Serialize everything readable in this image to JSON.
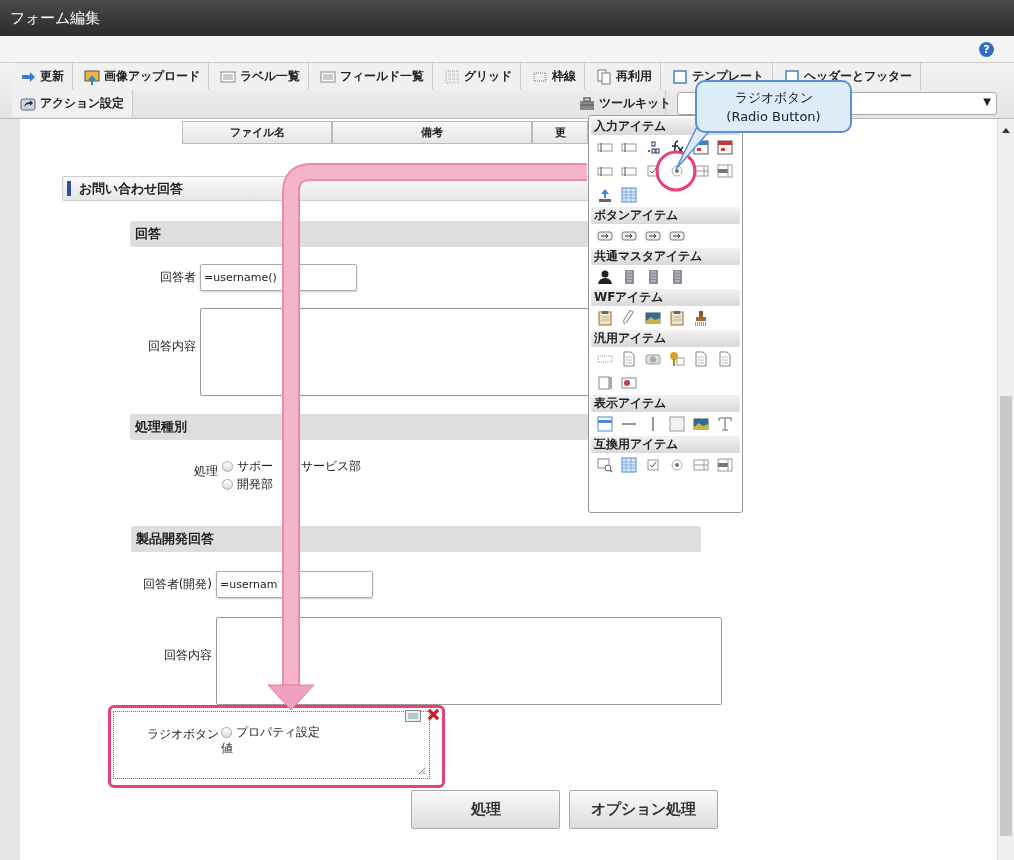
{
  "window": {
    "title": "フォーム編集",
    "help": "?"
  },
  "toolbar": {
    "tabs": [
      {
        "label": "更新"
      },
      {
        "label": "画像アップロード"
      },
      {
        "label": "ラベル一覧"
      },
      {
        "label": "フィールド一覧"
      },
      {
        "label": "グリッド"
      },
      {
        "label": "枠線"
      },
      {
        "label": "再利用"
      },
      {
        "label": "テンプレート"
      },
      {
        "label": "ヘッダーとフッター"
      }
    ],
    "row2": {
      "action": "アクション設定",
      "toolkit": "ツールキット",
      "dropdown_arrow": "▼"
    }
  },
  "table_header": {
    "columns": [
      "ファイル名",
      "備考",
      "更"
    ]
  },
  "form": {
    "section_title": "お問い合わせ回答",
    "groups": [
      {
        "title": "回答",
        "fields": [
          {
            "kind": "text",
            "label": "回答者",
            "value": "=username()"
          },
          {
            "kind": "textarea",
            "label": "回答内容"
          }
        ]
      },
      {
        "title": "処理種別",
        "fields": [
          {
            "kind": "radio",
            "label": "処理",
            "options": [
              {
                "label_parts": [
                  "サポー",
                  "サービス部"
                ],
                "selected": false
              },
              {
                "label": "開発部",
                "selected": false
              }
            ]
          }
        ]
      },
      {
        "title": "製品開発回答",
        "fields": [
          {
            "kind": "text",
            "label": "回答者(開発)",
            "value": "=usernam"
          },
          {
            "kind": "textarea",
            "label": "回答内容"
          }
        ]
      }
    ]
  },
  "selected_component": {
    "label": "ラジオボタン",
    "option": {
      "label": "プロパティ設定",
      "selected": false
    },
    "note": "値"
  },
  "buttons": [
    "処理",
    "オプション処理"
  ],
  "toolkit_panel": {
    "sections": [
      {
        "title": "入力アイテム"
      },
      {
        "title": "ボタンアイテム"
      },
      {
        "title": "共通マスタアイテム"
      },
      {
        "title": "WFアイテム"
      },
      {
        "title": "汎用アイテム"
      },
      {
        "title": "表示アイテム"
      },
      {
        "title": "互換用アイテム"
      }
    ]
  },
  "callout": {
    "lines": [
      "ラジオボタン",
      "(Radio Button)"
    ]
  }
}
